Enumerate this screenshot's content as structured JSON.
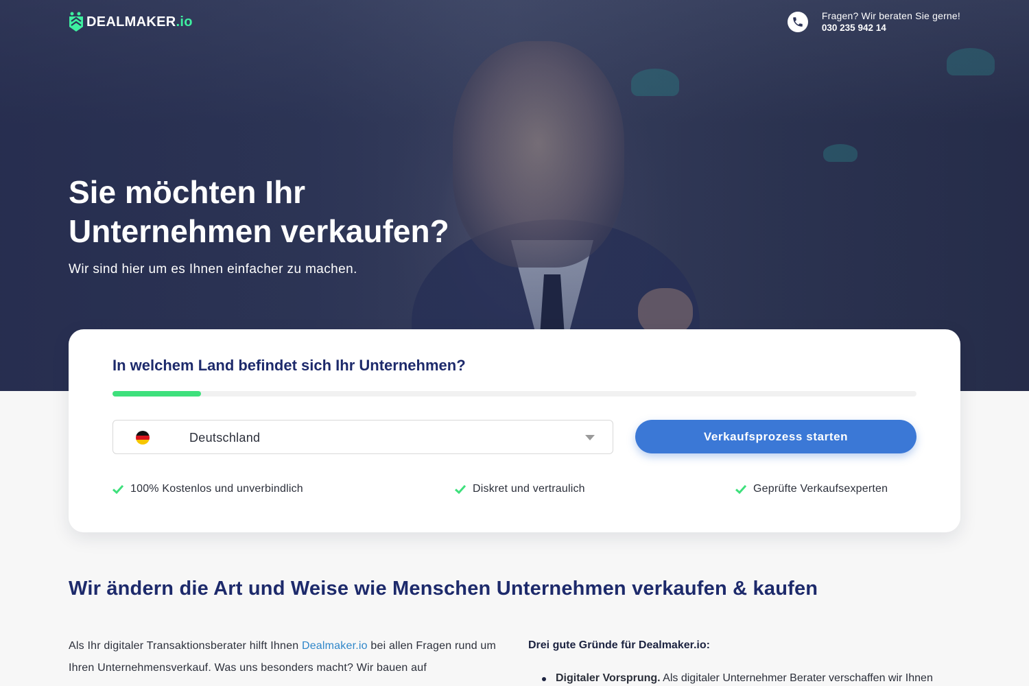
{
  "header": {
    "logo": {
      "brand": "DEALMAKER",
      "suffix": ".io"
    },
    "contact": {
      "question": "Fragen? Wir beraten Sie gerne!",
      "phone": "030 235 942 14",
      "icon": "phone-icon"
    }
  },
  "hero": {
    "title_line1": "Sie möchten Ihr",
    "title_line2": "Unternehmen verkaufen?",
    "subtitle": "Wir sind hier um es Ihnen einfacher zu machen."
  },
  "form": {
    "question": "In welchem Land befindet sich Ihr Unternehmen?",
    "progress": 0.11,
    "country": {
      "value": "Deutschland",
      "flag": "germany-flag-icon"
    },
    "cta_label": "Verkaufsprozess starten",
    "features": [
      {
        "label": "100% Kostenlos und unverbindlich"
      },
      {
        "label": "Diskret und vertraulich"
      },
      {
        "label": "Geprüfte Verkaufsexperten"
      }
    ]
  },
  "content": {
    "title": "Wir ändern die Art und Weise wie Menschen Unternehmen verkaufen & kaufen",
    "paragraph": {
      "before_link": "Als Ihr digitaler Transaktionsberater hilft Ihnen ",
      "link": "Dealmaker.io",
      "after_link": " bei allen Fragen rund um Ihren Unternehmensverkauf. Was uns besonders macht? Wir bauen auf"
    },
    "reasons_title": "Drei gute Gründe für Dealmaker.io:",
    "reasons": [
      {
        "bold": "Digitaler Vorsprung.",
        "text": " Als digitaler Unternehmer Berater verschaffen wir Ihnen"
      }
    ]
  },
  "colors": {
    "brand_navy": "#1d2a6b",
    "accent_green": "#3ee07c",
    "cta_blue": "#3b78d6",
    "link_blue": "#2f86c9"
  }
}
